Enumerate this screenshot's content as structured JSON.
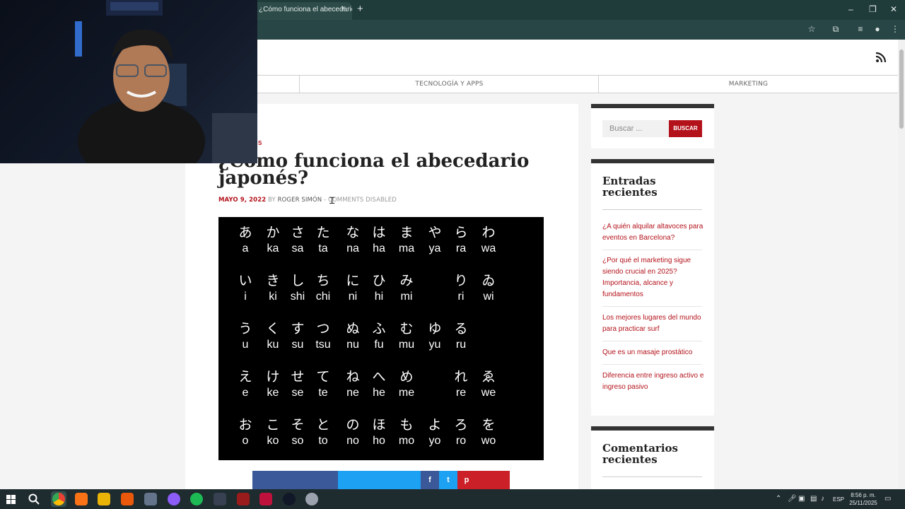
{
  "browser": {
    "tab_title": "¿Cómo funciona el abecedario japonés?",
    "tab_close": "×",
    "new_tab": "+",
    "window_controls": [
      "–",
      "❐",
      "✕"
    ]
  },
  "site": {
    "nav": [
      "",
      "TECNOLOGÍA Y APPS",
      "MARKETING"
    ]
  },
  "article": {
    "category": "S",
    "title": "¿Cómo funciona el abecedario japonés?",
    "date": "MAYO 9, 2022",
    "by": "BY",
    "author": "ROGER SIMÓN",
    "comments": "- COMMENTS DISABLED"
  },
  "kana_table": [
    [
      [
        "あ",
        "a"
      ],
      [
        "か",
        "ka"
      ],
      [
        "さ",
        "sa"
      ],
      [
        "た",
        "ta"
      ],
      [
        "な",
        "na"
      ],
      [
        "は",
        "ha"
      ],
      [
        "ま",
        "ma"
      ],
      [
        "や",
        "ya"
      ],
      [
        "ら",
        "ra"
      ],
      [
        "わ",
        "wa"
      ]
    ],
    [
      [
        "い",
        "i"
      ],
      [
        "き",
        "ki"
      ],
      [
        "し",
        "shi"
      ],
      [
        "ち",
        "chi"
      ],
      [
        "に",
        "ni"
      ],
      [
        "ひ",
        "hi"
      ],
      [
        "み",
        "mi"
      ],
      [
        "",
        ""
      ],
      [
        "り",
        "ri"
      ],
      [
        "ゐ",
        "wi"
      ]
    ],
    [
      [
        "う",
        "u"
      ],
      [
        "く",
        "ku"
      ],
      [
        "す",
        "su"
      ],
      [
        "つ",
        "tsu"
      ],
      [
        "ぬ",
        "nu"
      ],
      [
        "ふ",
        "fu"
      ],
      [
        "む",
        "mu"
      ],
      [
        "ゆ",
        "yu"
      ],
      [
        "る",
        "ru"
      ],
      [
        "",
        ""
      ]
    ],
    [
      [
        "え",
        "e"
      ],
      [
        "け",
        "ke"
      ],
      [
        "せ",
        "se"
      ],
      [
        "て",
        "te"
      ],
      [
        "ね",
        "ne"
      ],
      [
        "へ",
        "he"
      ],
      [
        "め",
        "me"
      ],
      [
        "",
        ""
      ],
      [
        "れ",
        "re"
      ],
      [
        "ゑ",
        "we"
      ]
    ],
    [
      [
        "お",
        "o"
      ],
      [
        "こ",
        "ko"
      ],
      [
        "そ",
        "so"
      ],
      [
        "と",
        "to"
      ],
      [
        "の",
        "no"
      ],
      [
        "ほ",
        "ho"
      ],
      [
        "も",
        "mo"
      ],
      [
        "よ",
        "yo"
      ],
      [
        "ろ",
        "ro"
      ],
      [
        "を",
        "wo"
      ]
    ]
  ],
  "share_icons": [
    "f",
    "t",
    "p"
  ],
  "sidebar": {
    "search_placeholder": "Buscar ...",
    "search_button": "BUSCAR",
    "recent_title": "Entradas recientes",
    "recent_posts": [
      "¿A quién alquilar altavoces para eventos en Barcelona?",
      "¿Por qué el marketing sigue siendo crucial en 2025? Importancia, alcance y fundamentos",
      "Los mejores lugares del mundo para practicar surf",
      "Que es un masaje prostático",
      "Diferencia entre ingreso activo e ingreso pasivo"
    ],
    "comments_title": "Comentarios recientes"
  },
  "taskbar": {
    "language": "ESP",
    "time": "8:56 p. m.",
    "date": "25/11/2025"
  },
  "colors": {
    "accent": "#b3121b",
    "browser_frame": "#1f3b3a",
    "taskbar": "#1e2b2f"
  }
}
